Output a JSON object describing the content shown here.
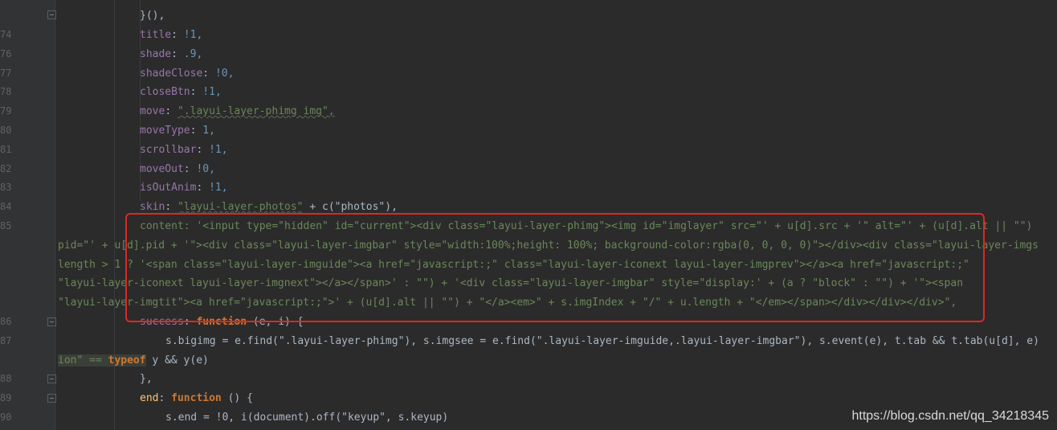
{
  "gutter": {
    "lines": [
      "74",
      "76",
      "77",
      "78",
      "79",
      "80",
      "81",
      "82",
      "83",
      "84",
      "85",
      "86",
      "87",
      "88",
      "89",
      "90"
    ]
  },
  "code": {
    "l0": "}(),",
    "l1_k": "title",
    "l1_v": "!1,",
    "l2_k": "shade",
    "l2_v": ".9,",
    "l3_k": "shadeClose",
    "l3_v": "!0,",
    "l4_k": "closeBtn",
    "l4_v": "!1,",
    "l5_k": "move",
    "l5_v": "\".layui-layer-phimg img\",",
    "l6_k": "moveType",
    "l6_v": "1,",
    "l7_k": "scrollbar",
    "l7_v": "!1,",
    "l8_k": "moveOut",
    "l8_v": "!0,",
    "l9_k": "isOutAnim",
    "l9_v": "!1,",
    "l10_k": "skin",
    "l10_a": "\"layui-layer-photos\"",
    "l10_b": " + c(\"photos\"),",
    "l11": "content: '<input type=\"hidden\" id=\"current\"><div class=\"layui-layer-phimg\"><img id=\"imglayer\" src=\"' + u[d].src + '\" alt=\"' + (u[d].alt || \"\")",
    "l12": "pid=\"' + u[d].pid + '\"><div class=\"layui-layer-imgbar\" style=\"width:100%;height: 100%; background-color:rgba(0, 0, 0, 0)\"></div><div class=\"layui-layer-imgs",
    "l13": "length > 1 ? '<span class=\"layui-layer-imguide\"><a href=\"javascript:;\" class=\"layui-layer-iconext layui-layer-imgprev\"></a><a href=\"javascript:;\"",
    "l14": "\"layui-layer-iconext layui-layer-imgnext\"></a></span>' : \"\") + '<div class=\"layui-layer-imgbar\" style=\"display:' + (a ? \"block\" : \"\") + '\"><span",
    "l15": "\"layui-layer-imgtit\"><a href=\"javascript:;\">' + (u[d].alt || \"\") + \"</a><em>\" + s.imgIndex + \"/\" + u.length + \"</em></span></div></div></div>\",",
    "l16_k": "success",
    "l16_f": "function",
    "l16_r": " (e, i) {",
    "l17": "s.bigimg = e.find(\".layui-layer-phimg\"), s.imgsee = e.find(\".layui-layer-imguide,.layui-layer-imgbar\"), s.event(e), t.tab && t.tab(u[d], e)",
    "l18_a": "ion\" == ",
    "l18_k": "typeof",
    "l18_b": " y && y(e)",
    "l19": "},",
    "l20_k": "end",
    "l20_f": "function",
    "l20_r": " () {",
    "l21": "s.end = !0, i(document).off(\"keyup\", s.keyup)"
  },
  "watermark": "https://blog.csdn.net/qq_34218345"
}
